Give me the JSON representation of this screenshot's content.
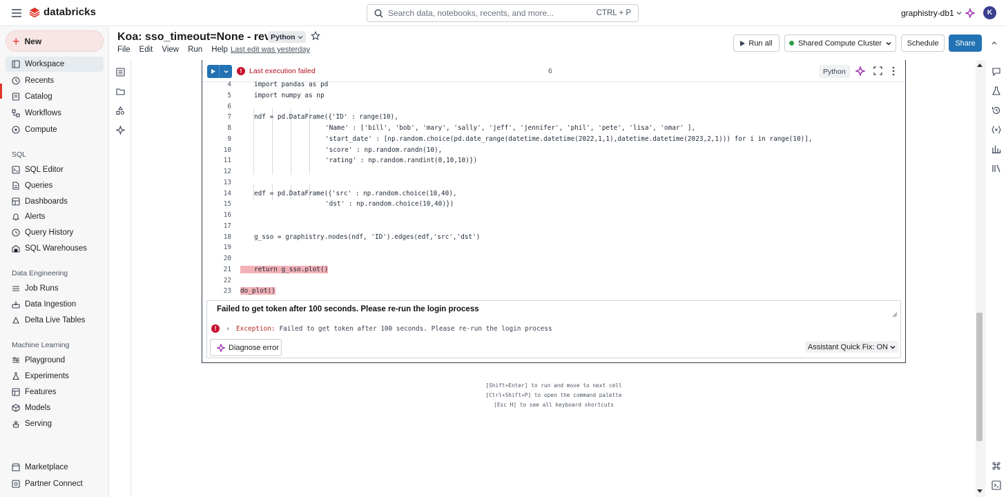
{
  "brand": {
    "name": "databricks"
  },
  "search": {
    "placeholder": "Search data, notebooks, recents, and more...",
    "shortcut": "CTRL + P"
  },
  "workspace_name": "graphistry-db1",
  "user_initial": "K",
  "sidebar": {
    "new_label": "New",
    "items": [
      {
        "label": "Workspace"
      },
      {
        "label": "Recents"
      },
      {
        "label": "Catalog"
      },
      {
        "label": "Workflows"
      },
      {
        "label": "Compute"
      }
    ],
    "sql_section": "SQL",
    "sql_items": [
      {
        "label": "SQL Editor"
      },
      {
        "label": "Queries"
      },
      {
        "label": "Dashboards"
      },
      {
        "label": "Alerts"
      },
      {
        "label": "Query History"
      },
      {
        "label": "SQL Warehouses"
      }
    ],
    "de_section": "Data Engineering",
    "de_items": [
      {
        "label": "Job Runs"
      },
      {
        "label": "Data Ingestion"
      },
      {
        "label": "Delta Live Tables"
      }
    ],
    "ml_section": "Machine Learning",
    "ml_items": [
      {
        "label": "Playground"
      },
      {
        "label": "Experiments"
      },
      {
        "label": "Features"
      },
      {
        "label": "Models"
      },
      {
        "label": "Serving"
      }
    ],
    "bottom_items": [
      {
        "label": "Marketplace"
      },
      {
        "label": "Partner Connect"
      }
    ]
  },
  "notebook": {
    "title": "Koa: sso_timeout=None - rev5",
    "language": "Python",
    "menus": [
      "File",
      "Edit",
      "View",
      "Run",
      "Help"
    ],
    "last_edit": "Last edit was yesterday",
    "run_all": "Run all",
    "cluster": "Shared Compute Cluster",
    "schedule": "Schedule",
    "share": "Share"
  },
  "cell": {
    "status": "Last execution failed",
    "number": "6",
    "language_tag": "Python",
    "line_numbers": [
      "4",
      "5",
      "6",
      "7",
      "8",
      "9",
      "10",
      "11",
      "12",
      "13",
      "14",
      "15",
      "16",
      "17",
      "18",
      "19",
      "20",
      "21",
      "22",
      "23"
    ],
    "code_lines": [
      "import pandas as pd",
      "import numpy as np",
      "",
      "ndf = pd.DataFrame({'ID' : range(10),",
      "'Name' : ['bill', 'bob', 'mary', 'sally', 'jeff', 'jennifer', 'phil', 'pete', 'lisa', 'omar' ],",
      "'start_date' : [np.random.choice(pd.date_range(datetime.datetime(2022,1,1),datetime.datetime(2023,2,1))) for i in range(10)],",
      "'score' : np.random.randn(10),",
      "'rating' : np.random.randint(0,10,10)})",
      "",
      "",
      "edf = pd.DataFrame({'src' : np.random.choice(10,40),",
      "'dst' : np.random.choice(10,40)})",
      "",
      "",
      "g_sso = graphistry.nodes(ndf, 'ID').edges(edf,'src','dst')",
      "",
      "",
      "return g_sso.plot()",
      "",
      "do_plot()"
    ],
    "error_title": "Failed to get token after 100 seconds. Please re-run the login process",
    "exception_label": "Exception:",
    "exception_message": "Failed to get token after 100 seconds. Please re-run the login process",
    "diagnose_label": "Diagnose error",
    "quick_fix_label": "Assistant Quick Fix: ON"
  },
  "hints": [
    "[Shift+Enter] to run and move to next cell",
    "[Ctrl+Shift+P] to open the command palette",
    "[Esc H] to see all keyboard shortcuts"
  ],
  "colors": {
    "accent": "#2272b4",
    "brand": "#e0362c",
    "error": "#c8102e"
  }
}
